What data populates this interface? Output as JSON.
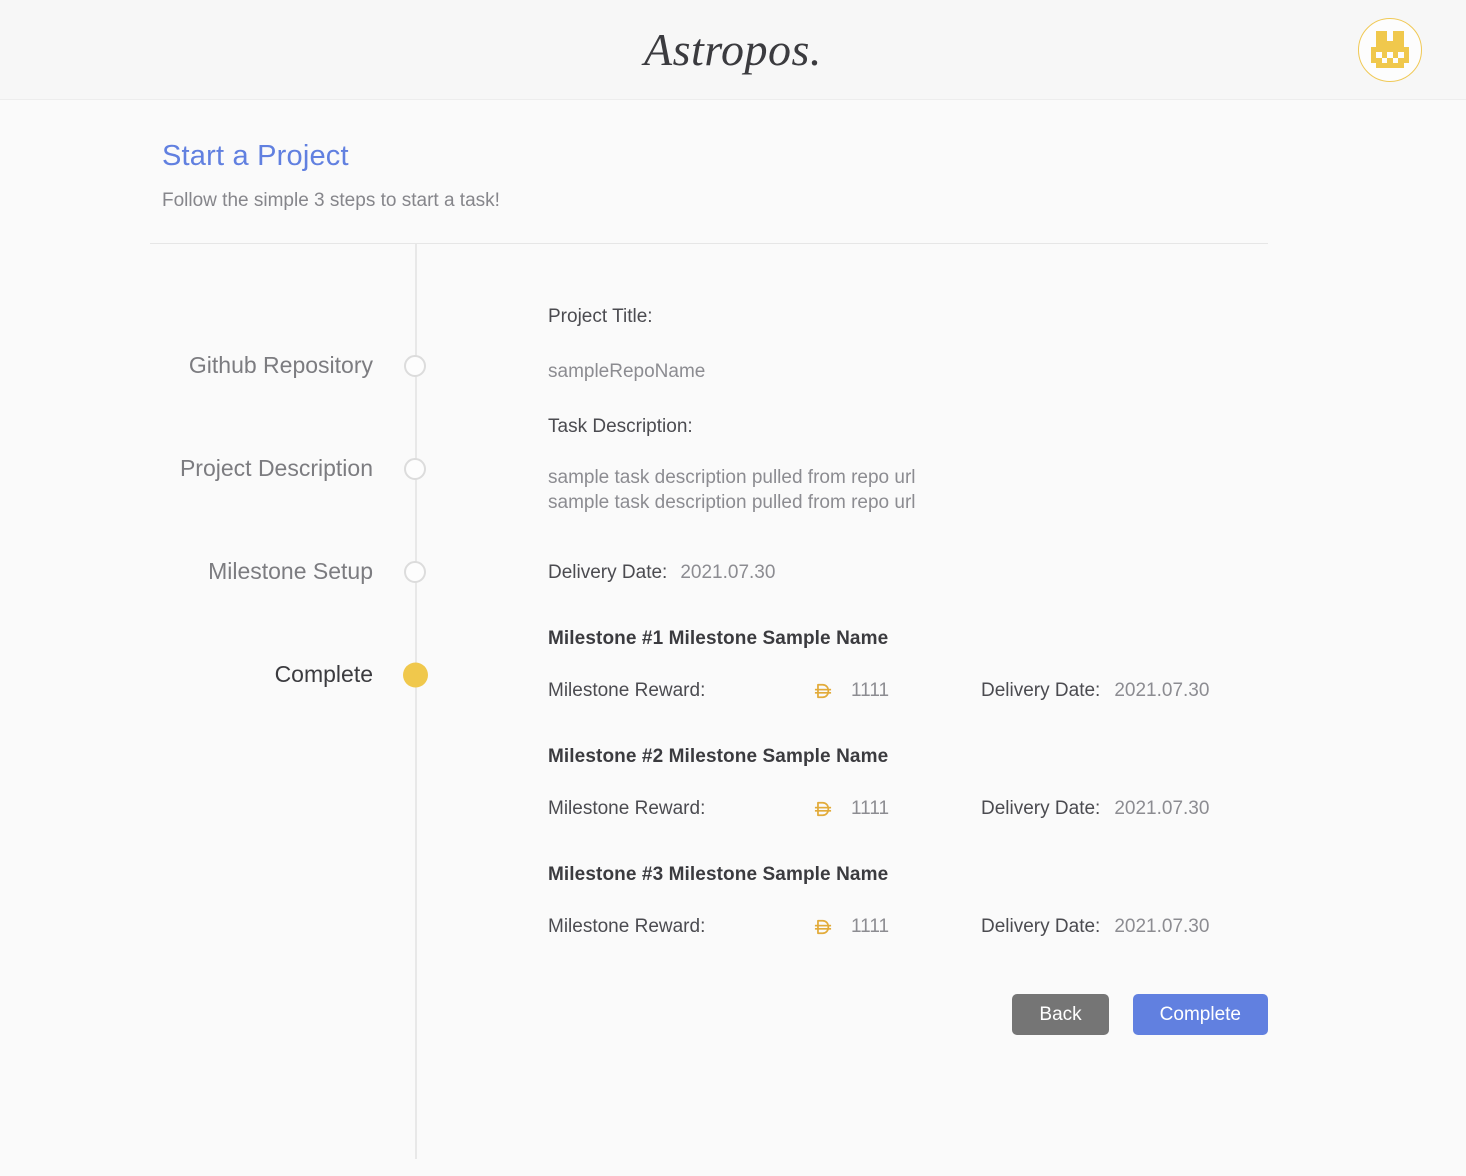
{
  "header": {
    "brand": "Astropos.",
    "avatar_icon": "identicon-avatar",
    "avatar_color": "#f0c84c"
  },
  "page": {
    "title": "Start a Project",
    "title_color": "#6180e0",
    "subtitle": "Follow the simple 3 steps to start a task!"
  },
  "stepper": {
    "active_index": 3,
    "active_color": "#f0c84c",
    "steps": [
      {
        "label": "Github Repository",
        "state": "pending"
      },
      {
        "label": "Project Description",
        "state": "pending"
      },
      {
        "label": "Milestone Setup",
        "state": "pending"
      },
      {
        "label": "Complete",
        "state": "active"
      }
    ]
  },
  "summary": {
    "project_title_label": "Project Title:",
    "project_title_value": "sampleRepoName",
    "task_description_label": "Task Description:",
    "task_description_lines": [
      "sample task description pulled from repo url",
      "sample task description pulled from repo url"
    ],
    "delivery_date_label": "Delivery Date:",
    "delivery_date_value": "2021.07.30"
  },
  "milestones": [
    {
      "title": "Milestone #1 Milestone Sample Name",
      "reward_label": "Milestone Reward:",
      "reward_icon": "dai-coin-icon",
      "reward_amount": "1111",
      "delivery_date_label": "Delivery Date:",
      "delivery_date_value": "2021.07.30"
    },
    {
      "title": "Milestone #2 Milestone Sample Name",
      "reward_label": "Milestone Reward:",
      "reward_icon": "dai-coin-icon",
      "reward_amount": "1111",
      "delivery_date_label": "Delivery Date:",
      "delivery_date_value": "2021.07.30"
    },
    {
      "title": "Milestone #3 Milestone Sample Name",
      "reward_label": "Milestone Reward:",
      "reward_icon": "dai-coin-icon",
      "reward_amount": "1111",
      "delivery_date_label": "Delivery Date:",
      "delivery_date_value": "2021.07.30"
    }
  ],
  "actions": {
    "back_label": "Back",
    "back_color": "#757575",
    "complete_label": "Complete",
    "complete_color": "#6180e0"
  }
}
